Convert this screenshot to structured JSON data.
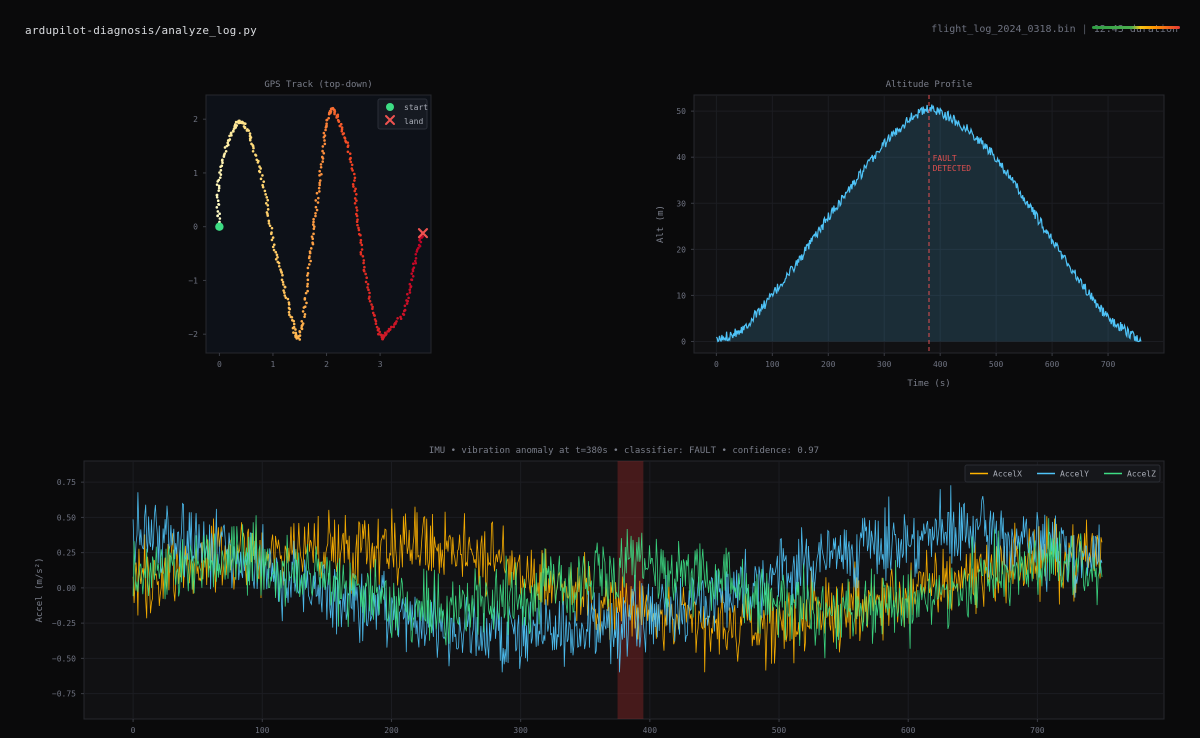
{
  "header": {
    "title": "ardupilot-diagnosis/analyze_log.py",
    "file": "flight_log_2024_0318.bin",
    "separator": "|",
    "duration": "12:43 duration"
  },
  "colors": {
    "background": "#0a0a0b",
    "panel": "#111113",
    "gps_panel": "#0d1118",
    "altitude_line": "#4fc3f7",
    "fault": "#e05050",
    "accel_x": "#ffb300",
    "accel_y": "#4fc3f7",
    "accel_z": "#3ddc84",
    "start_marker": "#3ddc84",
    "land_marker": "#ef5350"
  },
  "chart_data": [
    {
      "id": "gps",
      "type": "scatter",
      "title": "GPS Track (top-down)",
      "xlabel": "",
      "ylabel": "",
      "xlim": [
        -0.25,
        3.95
      ],
      "ylim": [
        -2.35,
        2.45
      ],
      "xticks": [
        0,
        1,
        2,
        3
      ],
      "yticks": [
        -2,
        -1,
        0,
        1,
        2
      ],
      "grid": false,
      "colormap": "YlOrRd (by time)",
      "legend": {
        "placement": "top-right",
        "entries": [
          {
            "label": "start",
            "marker": "circle",
            "color": "#3ddc84"
          },
          {
            "label": "land",
            "marker": "x",
            "color": "#ef5350"
          }
        ]
      },
      "start": [
        0.0,
        0.0
      ],
      "land": [
        3.8,
        -0.12
      ],
      "track": [
        [
          0.0,
          0.0
        ],
        [
          -0.03,
          0.4
        ],
        [
          -0.02,
          0.8
        ],
        [
          0.05,
          1.2
        ],
        [
          0.15,
          1.55
        ],
        [
          0.25,
          1.8
        ],
        [
          0.35,
          1.95
        ],
        [
          0.45,
          1.92
        ],
        [
          0.55,
          1.75
        ],
        [
          0.65,
          1.4
        ],
        [
          0.78,
          1.0
        ],
        [
          0.88,
          0.5
        ],
        [
          0.95,
          0.0
        ],
        [
          1.05,
          -0.5
        ],
        [
          1.15,
          -0.9
        ],
        [
          1.25,
          -1.3
        ],
        [
          1.35,
          -1.7
        ],
        [
          1.42,
          -2.02
        ],
        [
          1.48,
          -2.08
        ],
        [
          1.55,
          -1.8
        ],
        [
          1.62,
          -1.3
        ],
        [
          1.68,
          -0.7
        ],
        [
          1.74,
          -0.2
        ],
        [
          1.8,
          0.3
        ],
        [
          1.86,
          0.8
        ],
        [
          1.92,
          1.3
        ],
        [
          1.98,
          1.8
        ],
        [
          2.05,
          2.1
        ],
        [
          2.12,
          2.2
        ],
        [
          2.2,
          2.05
        ],
        [
          2.3,
          1.8
        ],
        [
          2.4,
          1.5
        ],
        [
          2.5,
          1.0
        ],
        [
          2.55,
          0.5
        ],
        [
          2.6,
          0.0
        ],
        [
          2.66,
          -0.5
        ],
        [
          2.75,
          -1.0
        ],
        [
          2.85,
          -1.5
        ],
        [
          2.95,
          -1.9
        ],
        [
          3.02,
          -2.08
        ],
        [
          3.1,
          -2.0
        ],
        [
          3.25,
          -1.85
        ],
        [
          3.45,
          -1.6
        ],
        [
          3.55,
          -1.2
        ],
        [
          3.62,
          -0.8
        ],
        [
          3.72,
          -0.4
        ],
        [
          3.8,
          -0.12
        ]
      ]
    },
    {
      "id": "altitude",
      "type": "area",
      "title": "Altitude Profile",
      "xlabel": "Time (s)",
      "ylabel": "Alt (m)",
      "xlim": [
        -40,
        800
      ],
      "ylim": [
        -2.5,
        53.5
      ],
      "xticks": [
        0,
        100,
        200,
        300,
        400,
        500,
        600,
        700
      ],
      "yticks": [
        0,
        10,
        20,
        30,
        40,
        50
      ],
      "grid": true,
      "fault_time": 380,
      "annotation": {
        "text_lines": [
          "FAULT",
          "DETECTED"
        ],
        "x": 390,
        "y": 39
      },
      "x": [
        0,
        50,
        100,
        150,
        200,
        250,
        300,
        350,
        380,
        400,
        450,
        500,
        550,
        600,
        650,
        700,
        760
      ],
      "values": [
        0,
        3,
        10,
        18,
        27,
        35,
        43,
        49,
        50.5,
        50,
        46,
        40,
        31,
        22,
        13,
        5,
        0
      ]
    },
    {
      "id": "imu",
      "type": "line",
      "title": "IMU  •  vibration anomaly at t=380s  •  classifier: FAULT  •  confidence: 0.97",
      "xlabel": "",
      "ylabel": "Accel (m/s²)",
      "xlim": [
        -38,
        798
      ],
      "ylim": [
        -0.93,
        0.9
      ],
      "xticks": [
        0,
        100,
        200,
        300,
        400,
        500,
        600,
        700
      ],
      "yticks": [
        -0.75,
        -0.5,
        -0.25,
        0.0,
        0.25,
        0.5,
        0.75
      ],
      "grid": true,
      "legend": {
        "placement": "top-right"
      },
      "anomaly_window": [
        375,
        395
      ],
      "x": [
        0,
        50,
        100,
        150,
        200,
        250,
        300,
        350,
        400,
        450,
        500,
        550,
        600,
        650,
        700,
        750
      ],
      "series": [
        {
          "name": "AccelX",
          "color": "#ffb300",
          "values": [
            0.05,
            0.2,
            0.25,
            0.28,
            0.32,
            0.3,
            0.12,
            -0.05,
            -0.2,
            -0.3,
            -0.25,
            -0.15,
            -0.05,
            0.1,
            0.2,
            0.25
          ]
        },
        {
          "name": "AccelY",
          "color": "#4fc3f7",
          "values": [
            0.4,
            0.3,
            0.15,
            -0.05,
            -0.2,
            -0.3,
            -0.35,
            -0.3,
            -0.2,
            -0.05,
            0.1,
            0.25,
            0.35,
            0.4,
            0.3,
            0.2
          ]
        },
        {
          "name": "AccelZ",
          "color": "#3ddc84",
          "values": [
            0.05,
            0.2,
            0.2,
            0.05,
            -0.1,
            -0.15,
            -0.05,
            0.05,
            0.15,
            0.05,
            -0.1,
            -0.2,
            -0.1,
            0.05,
            0.15,
            0.15
          ]
        }
      ]
    }
  ]
}
